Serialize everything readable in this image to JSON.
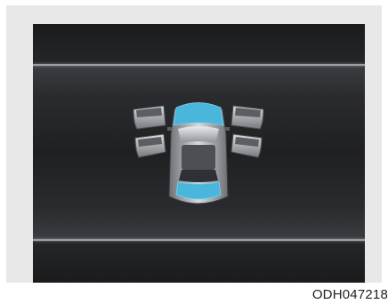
{
  "image_code": "ODH047218",
  "colors": {
    "background": "#e8e8e8",
    "screen": "#202123",
    "accent_cyan": "#4ab6dc",
    "guide_line": "#9aa0a8"
  },
  "icons": {
    "vehicle": "car-top-view-icon",
    "doors_open": [
      "front-left",
      "front-right",
      "rear-left",
      "rear-right"
    ],
    "highlighted_parts": [
      "hood",
      "trunk"
    ]
  }
}
